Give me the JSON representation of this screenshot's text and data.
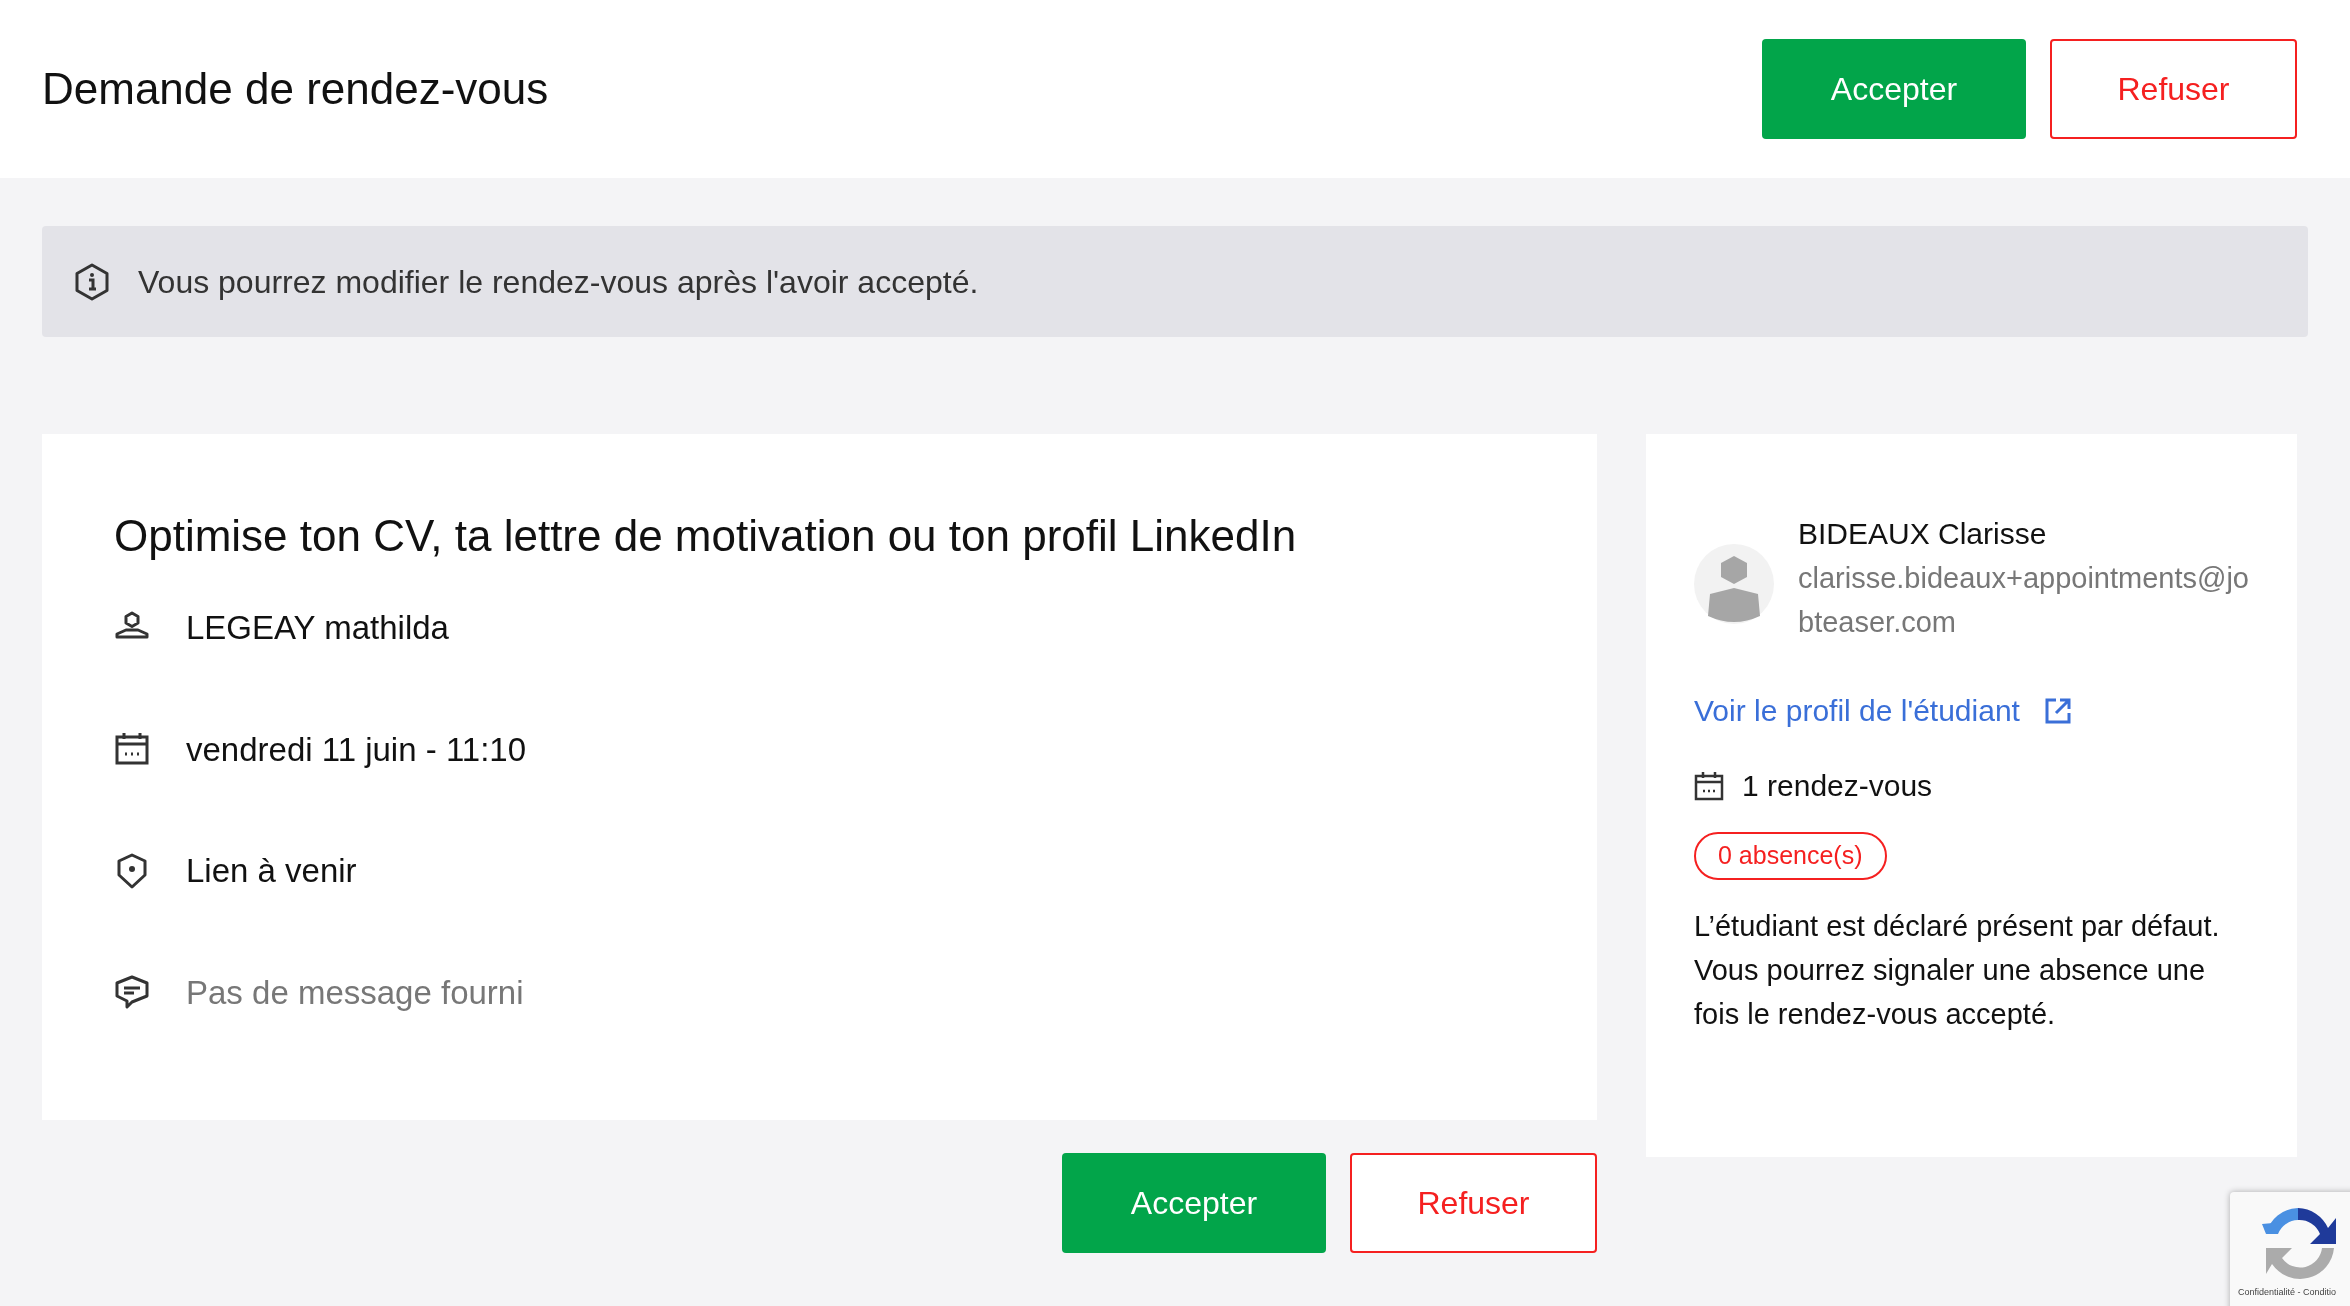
{
  "header": {
    "title": "Demande de rendez-vous",
    "actions": [
      {
        "label": "Accepter",
        "kind": "accept"
      },
      {
        "label": "Refuser",
        "kind": "refuse"
      }
    ]
  },
  "notice": {
    "text": "Vous pourrez modifier le rendez-vous après l'avoir accepté."
  },
  "appointment": {
    "title": "Optimise ton CV, ta lettre de motivation ou ton profil LinkedIn",
    "details": [
      {
        "kind": "person",
        "text": "LEGEAY mathilda",
        "muted": false
      },
      {
        "kind": "calendar",
        "text": "vendredi 11 juin - 11:10",
        "muted": false
      },
      {
        "kind": "location",
        "text": "Lien à venir",
        "muted": false
      },
      {
        "kind": "message",
        "text": "Pas de message fourni",
        "muted": true
      }
    ]
  },
  "footer_actions": [
    {
      "label": "Accepter",
      "kind": "accept"
    },
    {
      "label": "Refuser",
      "kind": "refuse"
    }
  ],
  "student": {
    "name": "BIDEAUX Clarisse",
    "email": "clarisse.bideaux+appointments@jobteaser.com",
    "profile_link": "Voir le profil de l'étudiant",
    "appointments": "1 rendez-vous",
    "absences": "0 absence(s)",
    "note": "L’étudiant est déclaré présent par défaut. Vous pourrez signaler une absence une fois le rendez-vous accepté."
  },
  "recaptcha": {
    "text": "Confidentialité - Conditio"
  }
}
